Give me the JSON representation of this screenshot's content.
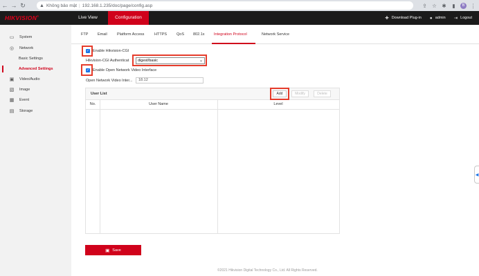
{
  "browser": {
    "security_label": "Không bảo mật",
    "url": "192.168.1.235/doc/page/config.asp",
    "profile_initial": "B"
  },
  "header": {
    "logo": "HIKVISION",
    "logo_mark": "®",
    "tabs": {
      "live_view": "Live View",
      "configuration": "Configuration"
    },
    "download_plugin": "Download Plug-in",
    "user": "admin",
    "logout": "Logout"
  },
  "sidebar": {
    "system": "System",
    "network": "Network",
    "basic_settings": "Basic Settings",
    "advanced_settings": "Advanced Settings",
    "video_audio": "Video/Audio",
    "image": "Image",
    "event": "Event",
    "storage": "Storage"
  },
  "subtabs": {
    "ftp": "FTP",
    "email": "Email",
    "platform_access": "Platform Access",
    "https": "HTTPS",
    "qos": "QoS",
    "dot1x": "802.1x",
    "integration_protocol": "Integration Protocol",
    "network_service": "Network Service"
  },
  "form": {
    "enable_cgi_label": "Enable Hikvision-CGI",
    "enable_cgi_checked": true,
    "cgi_auth_label": "Hikvision-CGI Authenticat",
    "cgi_auth_value": "digest/basic",
    "enable_onvif_label": "Enable Open Network Video Interface",
    "enable_onvif_checked": true,
    "onvif_version_label": "Open Network Video Inter...",
    "onvif_version_value": "18.12"
  },
  "user_list": {
    "title": "User List",
    "add": "Add",
    "modify": "Modify",
    "delete": "Delete",
    "columns": {
      "no": "No.",
      "user_name": "User Name",
      "level": "Level"
    }
  },
  "save_label": "Save",
  "footer": "©2021 Hikvision Digital Technology Co., Ltd. All Rights Reserved.",
  "colors": {
    "brand_red": "#d0021b",
    "highlight": "#e53b2a",
    "checkbox_blue": "#1a73e8"
  }
}
